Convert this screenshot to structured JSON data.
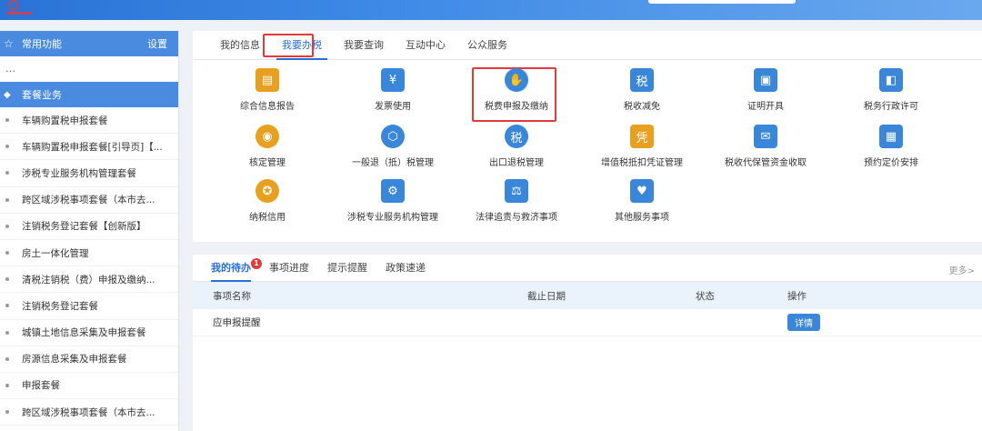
{
  "header": {
    "logo_text": ""
  },
  "sidebar": {
    "common_title": "常用功能",
    "settings_label": "设置",
    "dots": "…",
    "package_title": "套餐业务",
    "items": [
      "车辆购置税申报套餐",
      "车辆购置税申报套餐[引导页]【...",
      "涉税专业服务机构管理套餐",
      "跨区域涉税事项套餐（本市去...",
      "注销税务登记套餐【创新版】",
      "房土一体化管理",
      "清税注销税（费）申报及缴纳...",
      "注销税务登记套餐",
      "城镇土地信息采集及申报套餐",
      "房源信息采集及申报套餐",
      "申报套餐",
      "跨区域涉税事项套餐（本市去..."
    ]
  },
  "main_tabs": [
    "我的信息",
    "我要办税",
    "我要查询",
    "互动中心",
    "公众服务"
  ],
  "services": [
    {
      "label": "综合信息报告",
      "icon": "report-icon",
      "color": "#e8a020"
    },
    {
      "label": "发票使用",
      "icon": "invoice-icon",
      "color": "#3a86d8"
    },
    {
      "label": "税费申报及缴纳",
      "icon": "tax-payment-icon",
      "color": "#3a86d8"
    },
    {
      "label": "税收减免",
      "icon": "tax-relief-icon",
      "color": "#3a86d8"
    },
    {
      "label": "证明开具",
      "icon": "certificate-icon",
      "color": "#3a86d8"
    },
    {
      "label": "税务行政许可",
      "icon": "license-icon",
      "color": "#3a86d8"
    },
    {
      "label": "核定管理",
      "icon": "verify-icon",
      "color": "#e8a020"
    },
    {
      "label": "一般退（抵）税管理",
      "icon": "refund-icon",
      "color": "#3a86d8"
    },
    {
      "label": "出口退税管理",
      "icon": "export-refund-icon",
      "color": "#3a86d8"
    },
    {
      "label": "增值税抵扣凭证管理",
      "icon": "vat-icon",
      "color": "#e8a020"
    },
    {
      "label": "税收代保管资金收取",
      "icon": "custody-icon",
      "color": "#3a86d8"
    },
    {
      "label": "预约定价安排",
      "icon": "calendar-icon",
      "color": "#3a86d8"
    },
    {
      "label": "纳税信用",
      "icon": "credit-icon",
      "color": "#e8a020"
    },
    {
      "label": "涉税专业服务机构管理",
      "icon": "agency-icon",
      "color": "#3a86d8"
    },
    {
      "label": "法律追责与救济事项",
      "icon": "gavel-icon",
      "color": "#3a86d8"
    },
    {
      "label": "其他服务事项",
      "icon": "heart-icon",
      "color": "#3a86d8"
    }
  ],
  "todo": {
    "tabs": [
      "我的待办",
      "事项进度",
      "提示提醒",
      "政策速递"
    ],
    "badge": "1",
    "more": "更多>",
    "columns": [
      "事项名称",
      "截止日期",
      "状态",
      "操作"
    ],
    "rows": [
      {
        "name": "应申报提醒",
        "deadline": "",
        "status": "",
        "action": "详情"
      }
    ]
  }
}
